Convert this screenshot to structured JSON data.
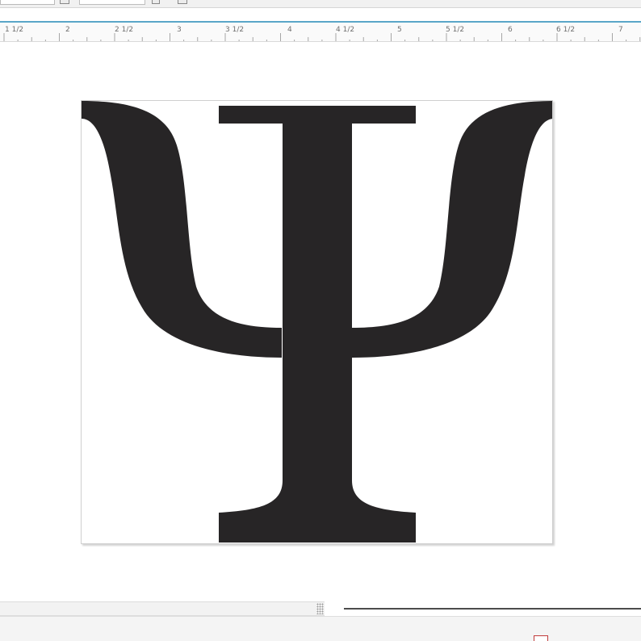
{
  "toolbar": {
    "controls": [
      "dropdown-edge",
      "copy-icon",
      "value-field",
      "zoom-icon",
      "fit-icon"
    ]
  },
  "ruler": {
    "unit": "inches",
    "labels": [
      "1 1/2",
      "2",
      "2 1/2",
      "3",
      "3 1/2",
      "4",
      "4 1/2",
      "5",
      "5 1/2",
      "6",
      "6 1/2",
      "7"
    ],
    "accent_color": "#5aa6c8"
  },
  "canvas": {
    "glyph_character": "Ψ",
    "glyph_name": "psi-symbol",
    "glyph_color": "#272526",
    "page_color": "#ffffff"
  },
  "scrollbars": {
    "horizontal": "scrollbar",
    "vertical_marker": "status-marker"
  }
}
